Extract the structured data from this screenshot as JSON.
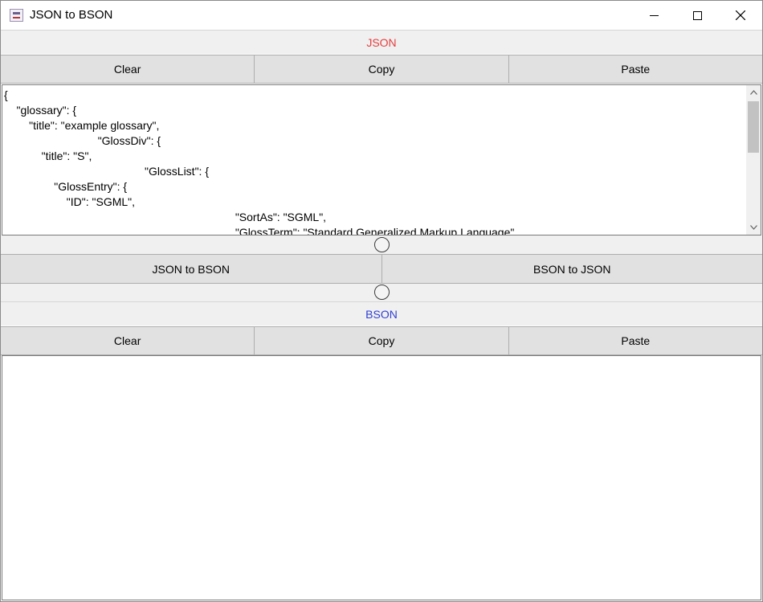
{
  "window": {
    "title": "JSON to BSON",
    "controls": {
      "minimize_icon": "minimize-icon",
      "maximize_icon": "maximize-icon",
      "close_icon": "close-icon"
    }
  },
  "json_section": {
    "header": "JSON",
    "header_color": "#e53d3d",
    "buttons": {
      "clear": "Clear",
      "copy": "Copy",
      "paste": "Paste"
    },
    "content": "{\n    \"glossary\": {\n        \"title\": \"example glossary\",\n                              \"GlossDiv\": {\n            \"title\": \"S\",\n                                             \"GlossList\": {\n                \"GlossEntry\": {\n                    \"ID\": \"SGML\",\n                                                                          \"SortAs\": \"SGML\",\n                                                                          \"GlossTerm\": \"Standard Generalized Markup Language\","
  },
  "convert": {
    "json_to_bson": "JSON to BSON",
    "bson_to_json": "BSON to JSON"
  },
  "bson_section": {
    "header": "BSON",
    "header_color": "#2f3fd6",
    "buttons": {
      "clear": "Clear",
      "copy": "Copy",
      "paste": "Paste"
    },
    "content": ""
  }
}
